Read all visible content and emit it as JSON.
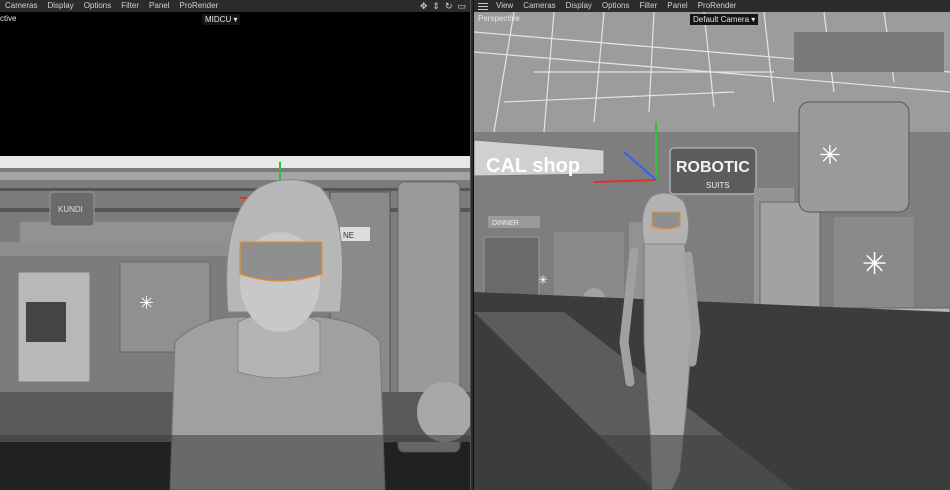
{
  "left_viewport": {
    "projection": "ctive",
    "camera": "MIDCU",
    "menu": [
      "Cameras",
      "Display",
      "Options",
      "Filter",
      "Panel",
      "ProRender"
    ]
  },
  "right_viewport": {
    "projection": "Perspective",
    "camera": "Default Camera",
    "menu": [
      "View",
      "Cameras",
      "Display",
      "Options",
      "Filter",
      "Panel",
      "ProRender"
    ]
  },
  "scene_signs": {
    "shop": "CAL shop",
    "robotic": "ROBOTIC",
    "suits": "SUITS",
    "dinner": "DINNER",
    "bar_sign": "NE",
    "arcade": "KUNDI"
  },
  "colors": {
    "menubar": "#2b2b2b",
    "axis_x": "#e03030",
    "axis_y": "#30c040",
    "axis_z": "#3060ff",
    "highlight": "#e09030"
  }
}
